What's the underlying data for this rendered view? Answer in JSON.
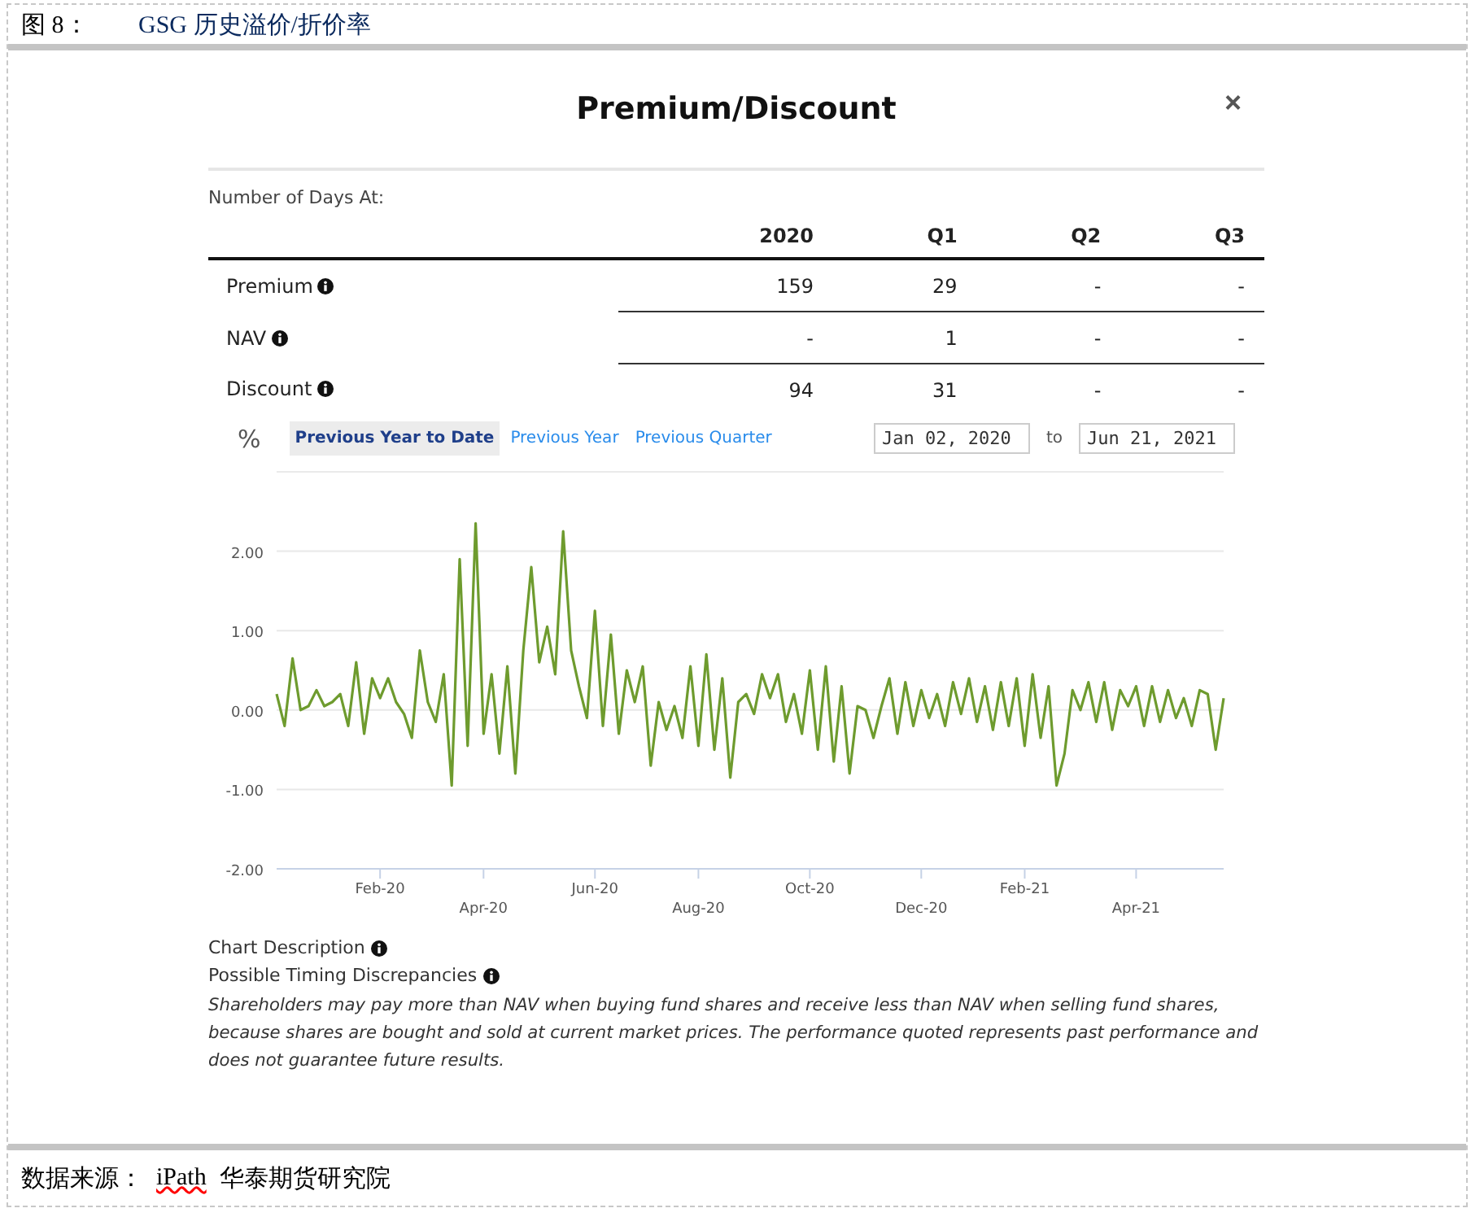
{
  "figure": {
    "number": "图 8：",
    "title": "GSG 历史溢价/折价率"
  },
  "modal": {
    "title": "Premium/Discount",
    "close": "×"
  },
  "table": {
    "caption": "Number of Days At:",
    "columns": [
      "2020",
      "Q1",
      "Q2",
      "Q3"
    ],
    "rows": [
      {
        "label": "Premium",
        "cells": [
          "159",
          "29",
          "-",
          "-"
        ]
      },
      {
        "label": "NAV",
        "cells": [
          "-",
          "1",
          "-",
          "-"
        ]
      },
      {
        "label": "Discount",
        "cells": [
          "94",
          "31",
          "-",
          "-"
        ]
      }
    ]
  },
  "unit": "%",
  "periods": [
    {
      "label": "Previous Year to Date",
      "selected": true
    },
    {
      "label": "Previous Year",
      "selected": false
    },
    {
      "label": "Previous Quarter",
      "selected": false
    }
  ],
  "date_range": {
    "from": "Jan 02, 2020",
    "separator": "to",
    "to": "Jun 21, 2021"
  },
  "chart_data": {
    "type": "line",
    "grid": true,
    "ylim": [
      -2,
      3
    ],
    "categories": [
      null,
      null,
      null,
      null,
      null,
      null,
      null,
      null,
      null,
      null,
      null,
      null,
      null,
      "Feb-20",
      null,
      null,
      null,
      null,
      null,
      null,
      null,
      null,
      null,
      null,
      null,
      null,
      "Apr-20",
      null,
      null,
      null,
      null,
      null,
      null,
      null,
      null,
      null,
      null,
      null,
      null,
      null,
      "Jun-20",
      null,
      null,
      null,
      null,
      null,
      null,
      null,
      null,
      null,
      null,
      null,
      null,
      "Aug-20",
      null,
      null,
      null,
      null,
      null,
      null,
      null,
      null,
      null,
      null,
      null,
      null,
      null,
      "Oct-20",
      null,
      null,
      null,
      null,
      null,
      null,
      null,
      null,
      null,
      null,
      null,
      null,
      null,
      "Dec-20",
      null,
      null,
      null,
      null,
      null,
      null,
      null,
      null,
      null,
      null,
      null,
      null,
      "Feb-21",
      null,
      null,
      null,
      null,
      null,
      null,
      null,
      null,
      null,
      null,
      null,
      null,
      null,
      "Apr-21",
      null,
      null,
      null,
      null,
      null,
      null,
      null,
      null,
      null,
      null,
      null
    ],
    "yticks": [
      {
        "value": -2,
        "label": "-2.00"
      },
      {
        "value": -1,
        "label": "-1.00"
      },
      {
        "value": 0,
        "label": "0.00"
      },
      {
        "value": 1,
        "label": "1.00"
      },
      {
        "value": 2,
        "label": "2.00"
      }
    ],
    "series": [
      {
        "color": "#6e9b2e",
        "values": [
          0.2,
          -0.2,
          0.65,
          0,
          0.05,
          0.25,
          0.05,
          0.1,
          0.2,
          -0.2,
          0.6,
          -0.3,
          0.4,
          0.15,
          0.4,
          0.1,
          -0.05,
          -0.35,
          0.75,
          0.1,
          -0.15,
          0.45,
          -0.95,
          1.9,
          -0.45,
          2.35,
          -0.3,
          0.45,
          -0.55,
          0.55,
          -0.8,
          0.75,
          1.8,
          0.6,
          1.05,
          0.45,
          2.25,
          0.75,
          0.3,
          -0.1,
          1.25,
          -0.2,
          0.95,
          -0.3,
          0.5,
          0.1,
          0.55,
          -0.7,
          0.1,
          -0.25,
          0.05,
          -0.35,
          0.55,
          -0.45,
          0.7,
          -0.5,
          0.4,
          -0.85,
          0.1,
          0.2,
          -0.05,
          0.45,
          0.15,
          0.45,
          -0.15,
          0.2,
          -0.3,
          0.5,
          -0.5,
          0.55,
          -0.65,
          0.3,
          -0.8,
          0.05,
          0,
          -0.35,
          0.05,
          0.4,
          -0.3,
          0.35,
          -0.2,
          0.25,
          -0.1,
          0.2,
          -0.2,
          0.35,
          -0.05,
          0.4,
          -0.15,
          0.3,
          -0.25,
          0.35,
          -0.2,
          0.4,
          -0.45,
          0.45,
          -0.35,
          0.3,
          -0.95,
          -0.55,
          0.25,
          0,
          0.35,
          -0.15,
          0.35,
          -0.25,
          0.25,
          0.05,
          0.3,
          -0.2,
          0.3,
          -0.15,
          0.25,
          -0.1,
          0.15,
          -0.2,
          0.25,
          0.2,
          -0.5,
          0.15
        ]
      }
    ]
  },
  "notes": [
    {
      "label": "Chart Description"
    },
    {
      "label": "Possible Timing Discrepancies"
    }
  ],
  "disclaimer": "Shareholders may pay more than NAV when buying fund shares and receive less than NAV when selling fund shares, because shares are bought and sold at current market prices. The performance quoted represents past performance and does not guarantee future results.",
  "source": [
    {
      "text": "数据来源："
    },
    {
      "text": "iPath",
      "misspelled": true
    },
    {
      "text": "华泰期货研究院"
    }
  ]
}
